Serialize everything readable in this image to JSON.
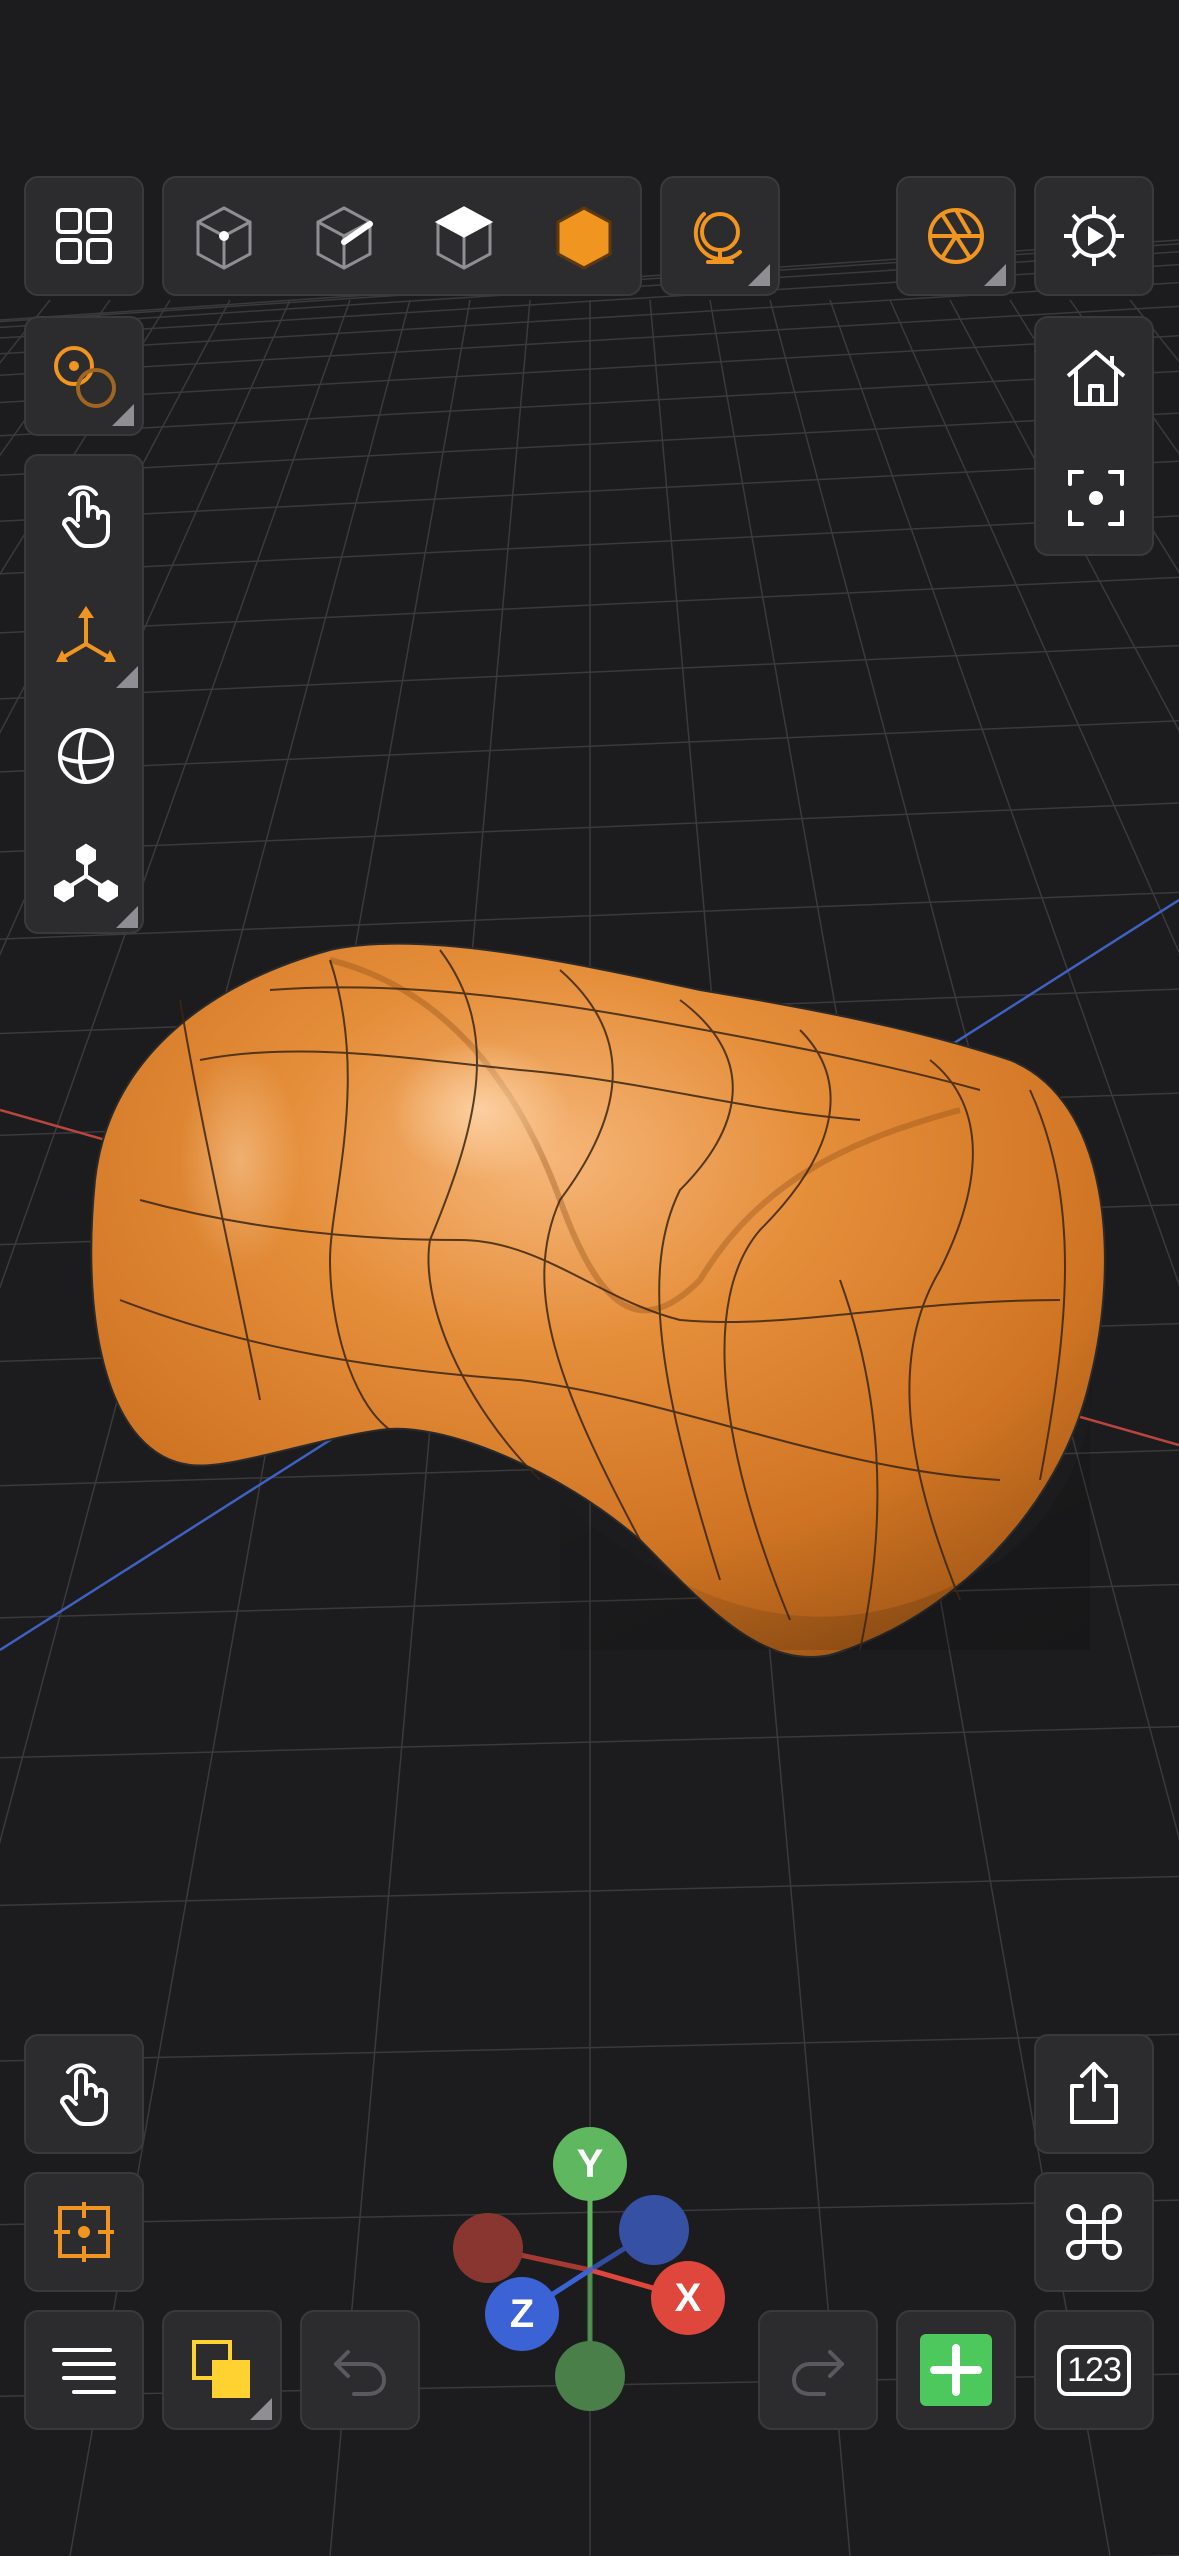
{
  "toolbar_top": {
    "grid_menu_icon": "grid-menu-icon",
    "select_modes": [
      "vertex-mode-icon",
      "edge-mode-icon",
      "face-mode-icon",
      "object-mode-icon"
    ],
    "active_select_mode": "object",
    "orbit_icon": "orbit-icon",
    "render_icon": "aperture-icon",
    "settings_icon": "settings-gear-icon"
  },
  "toolbar_left": [
    "pivot-icon",
    "hand-tap-icon",
    "move-arrows-icon",
    "sphere-icon",
    "hierarchy-icon"
  ],
  "toolbar_right": [
    "home-icon",
    "focus-frame-icon"
  ],
  "bottom_left": [
    "hand-tap-icon",
    "snap-target-icon",
    "outline-list-icon",
    "layers-copy-icon",
    "undo-icon"
  ],
  "bottom_right": [
    "share-icon",
    "command-icon",
    "redo-icon",
    "add-object-icon"
  ],
  "numeric_input_label": "123",
  "gizmo": {
    "y_label": "Y",
    "x_label": "X",
    "z_label": "Z"
  },
  "colors": {
    "accent": "#f0951f",
    "model": "#e08a33",
    "axis_x": "#e0473c",
    "axis_y": "#5fb860",
    "axis_z": "#3c63d6",
    "add": "#4cc85d",
    "layer_front": "#ffd232"
  }
}
